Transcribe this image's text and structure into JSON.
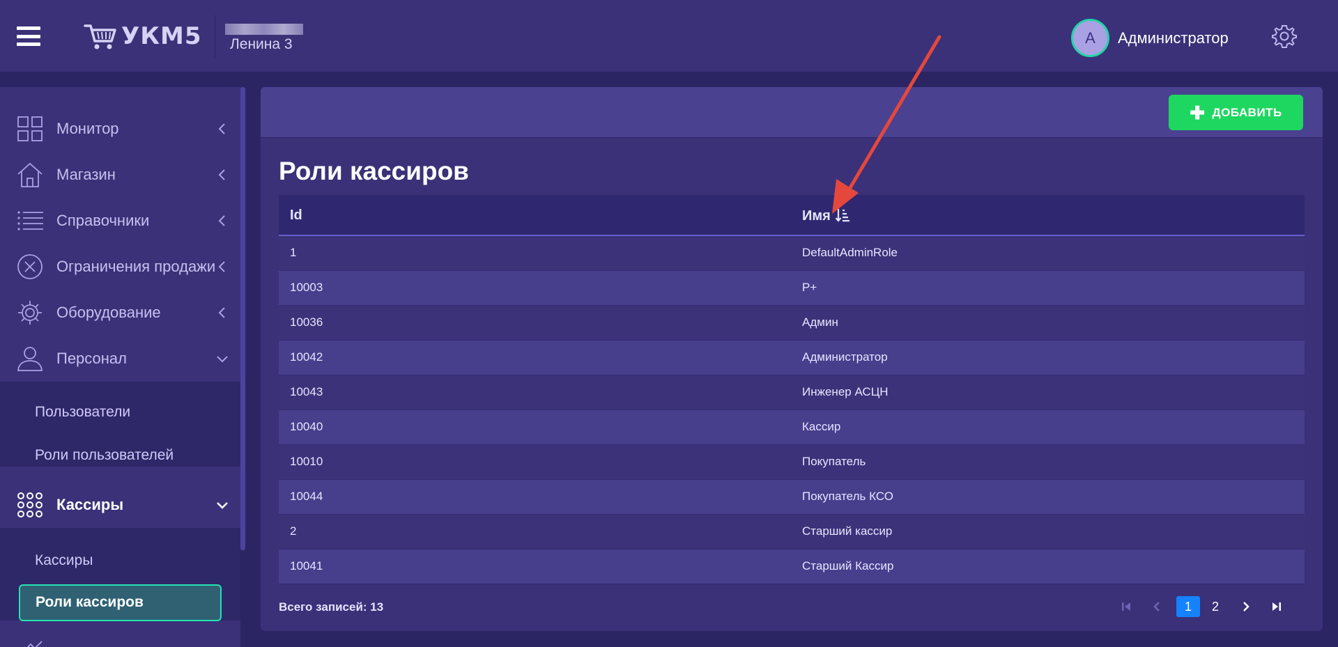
{
  "header": {
    "logo_text": "УКМ5",
    "store_name": "Ленина 3",
    "user_initial": "А",
    "user_name": "Администратор"
  },
  "sidebar": {
    "items": [
      {
        "label": "Монитор",
        "icon": "grid-icon"
      },
      {
        "label": "Магазин",
        "icon": "house-icon"
      },
      {
        "label": "Справочники",
        "icon": "list-icon"
      },
      {
        "label": "Ограничения продажи",
        "icon": "circle-x-icon"
      },
      {
        "label": "Оборудование",
        "icon": "gear-icon"
      },
      {
        "label": "Персонал",
        "icon": "person-icon"
      },
      {
        "label": "Кассиры",
        "icon": "dots-grid-icon"
      }
    ],
    "personnel_sub": [
      "Пользователи",
      "Роли пользователей"
    ],
    "cashiers_sub": [
      "Кассиры",
      "Роли кассиров"
    ]
  },
  "toolbar": {
    "add_label": "ДОБАВИТЬ"
  },
  "page": {
    "title": "Роли кассиров"
  },
  "table": {
    "columns": [
      "Id",
      "Имя"
    ],
    "sort": "Имя ascending",
    "rows": [
      {
        "id": "1",
        "name": "DefaultAdminRole"
      },
      {
        "id": "10003",
        "name": "Р+"
      },
      {
        "id": "10036",
        "name": "Админ"
      },
      {
        "id": "10042",
        "name": "Администратор"
      },
      {
        "id": "10043",
        "name": "Инженер АСЦН"
      },
      {
        "id": "10040",
        "name": "Кассир"
      },
      {
        "id": "10010",
        "name": "Покупатель"
      },
      {
        "id": "10044",
        "name": "Покупатель КСО"
      },
      {
        "id": "2",
        "name": "Старший кассир"
      },
      {
        "id": "10041",
        "name": "Старший Кассир"
      }
    ]
  },
  "footer": {
    "total": "Всего записей: 13"
  },
  "pagination": {
    "current": "1",
    "pages": [
      "1",
      "2"
    ]
  },
  "colors": {
    "accent": "#1ed760",
    "page_active": "#1582ff",
    "highlight": "#23e3b0",
    "annotation_arrow": "#e4483d"
  }
}
